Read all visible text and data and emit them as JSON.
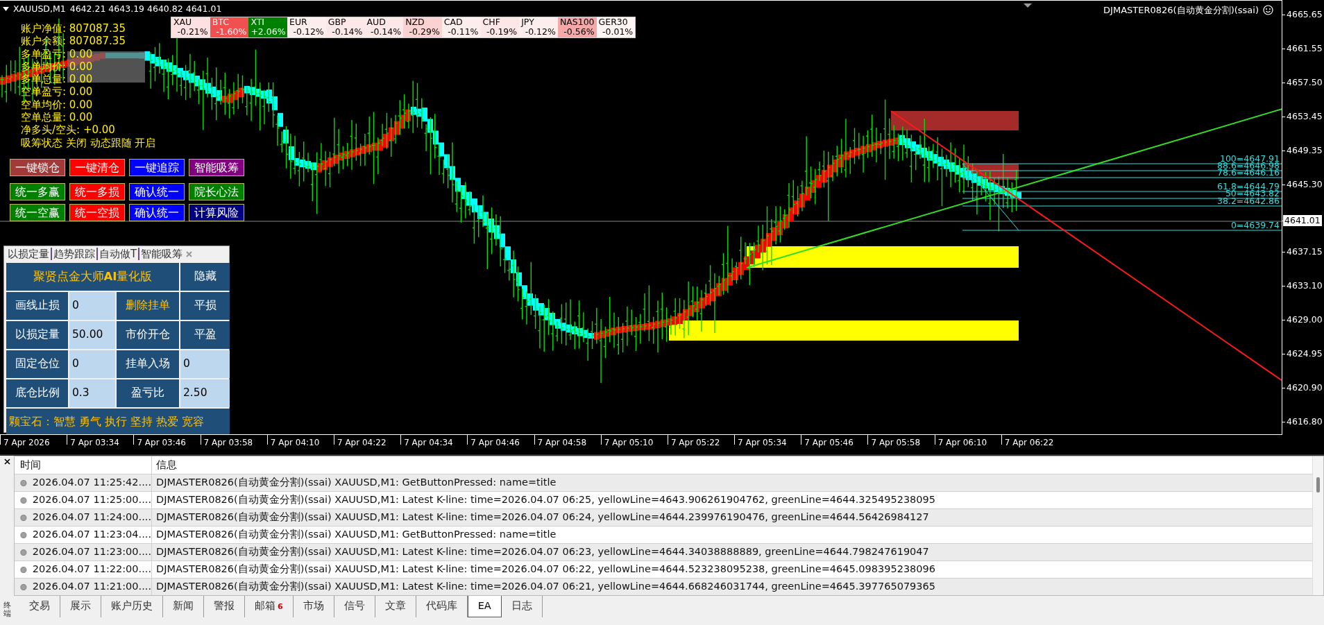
{
  "chart": {
    "symbol": "XAUUSD,M1",
    "quotes": "4642.21 4643.19 4640.82 4641.01",
    "expert": "DJMASTER0826(自动黄金分割)(ssai)"
  },
  "currency_strip": [
    {
      "symbol": "XAU",
      "change": "-0.21%",
      "color": "#fde0e0"
    },
    {
      "symbol": "BTC",
      "change": "-1.60%",
      "color": "#f05050"
    },
    {
      "symbol": "XTI",
      "change": "+2.06%",
      "color": "#008000"
    },
    {
      "symbol": "EUR",
      "change": "-0.12%",
      "color": "#fdeeee"
    },
    {
      "symbol": "GBP",
      "change": "-0.14%",
      "color": "#fde8e8"
    },
    {
      "symbol": "AUD",
      "change": "-0.14%",
      "color": "#fde8e8"
    },
    {
      "symbol": "NZD",
      "change": "-0.29%",
      "color": "#fbd2d2"
    },
    {
      "symbol": "CAD",
      "change": "-0.11%",
      "color": "#fdeeee"
    },
    {
      "symbol": "CHF",
      "change": "-0.19%",
      "color": "#fde6e6"
    },
    {
      "symbol": "JPY",
      "change": "-0.12%",
      "color": "#fdeeee"
    },
    {
      "symbol": "NAS100",
      "change": "-0.56%",
      "color": "#f5a8a8"
    },
    {
      "symbol": "GER30",
      "change": "-0.01%",
      "color": "#fff4f4"
    }
  ],
  "account_lines": [
    "账户净值: 807087.35",
    "账户余额: 807087.35",
    "多单盈亏: 0.00",
    "多单均价: 0.00",
    "多单总量: 0.00",
    "空单盈亏: 0.00",
    "空单均价: 0.00",
    "空单总量: 0.00",
    "净多头/空头: +0.00",
    "吸筹状态 关闭 动态跟随 开启"
  ],
  "action_buttons": [
    [
      {
        "label": "一键锁仓",
        "color": "#a33a3a"
      },
      {
        "label": "一键清仓",
        "color": "#ff0000"
      },
      {
        "label": "一键追踪",
        "color": "#0000ff"
      },
      {
        "label": "智能吸筹",
        "color": "#800080"
      }
    ],
    [
      {
        "label": "统一多赢",
        "color": "#008000"
      },
      {
        "label": "统一多损",
        "color": "#ff0000"
      },
      {
        "label": "确认统一",
        "color": "#0000ff"
      },
      {
        "label": "院长心法",
        "color": "#008000"
      }
    ],
    [
      {
        "label": "统一空赢",
        "color": "#008000"
      },
      {
        "label": "统一空损",
        "color": "#ff0000"
      },
      {
        "label": "确认统一",
        "color": "#0000ff"
      },
      {
        "label": "计算风险",
        "color": "#000080"
      }
    ]
  ],
  "fibonacci_levels": [
    "100=4647.91",
    "88.6=4646.98",
    "78.6=4646.16",
    "61.8=4644.79",
    "50=4643.82",
    "38.2=4642.86",
    "0=4639.74"
  ],
  "price_axis": [
    {
      "label": "4665.65",
      "kind": "tick"
    },
    {
      "label": "4661.55",
      "kind": "tick"
    },
    {
      "label": "4657.50",
      "kind": "tick"
    },
    {
      "label": "4653.45",
      "kind": "tick"
    },
    {
      "label": "4649.35",
      "kind": "tick"
    },
    {
      "label": "4645.30",
      "kind": "tick"
    },
    {
      "label": "4641.01",
      "kind": "current"
    },
    {
      "label": "4637.15",
      "kind": "tick"
    },
    {
      "label": "4633.10",
      "kind": "tick"
    },
    {
      "label": "4629.00",
      "kind": "tick"
    },
    {
      "label": "4624.95",
      "kind": "tick"
    },
    {
      "label": "4620.90",
      "kind": "tick"
    },
    {
      "label": "4616.80",
      "kind": "tick"
    }
  ],
  "time_axis": [
    "7 Apr 2026",
    "7 Apr 03:34",
    "7 Apr 03:46",
    "7 Apr 03:58",
    "7 Apr 04:10",
    "7 Apr 04:22",
    "7 Apr 04:34",
    "7 Apr 04:46",
    "7 Apr 04:58",
    "7 Apr 05:10",
    "7 Apr 05:22",
    "7 Apr 05:34",
    "7 Apr 05:46",
    "7 Apr 05:58",
    "7 Apr 06:10",
    "7 Apr 06:22"
  ],
  "panel": {
    "tabs": [
      "以损定量",
      "趋势跟踪",
      "自动做T",
      "智能吸筹"
    ],
    "title": "聚贤点金大师**AI**量化版",
    "hide_button": "隐藏",
    "rows": [
      [
        {
          "kind": "label",
          "text": "画线止损"
        },
        {
          "kind": "value",
          "text": "0"
        },
        {
          "kind": "accent",
          "text": "删除挂单"
        },
        {
          "kind": "label",
          "text": "平损"
        }
      ],
      [
        {
          "kind": "label",
          "text": "以损定量"
        },
        {
          "kind": "value",
          "text": "50.00"
        },
        {
          "kind": "label",
          "text": "市价开仓"
        },
        {
          "kind": "label",
          "text": "平盈"
        }
      ],
      [
        {
          "kind": "label",
          "text": "固定仓位"
        },
        {
          "kind": "value",
          "text": "0"
        },
        {
          "kind": "label",
          "text": "挂单入场"
        },
        {
          "kind": "value",
          "text": "0"
        }
      ],
      [
        {
          "kind": "label",
          "text": "底仓比例"
        },
        {
          "kind": "value",
          "text": "0.3"
        },
        {
          "kind": "label",
          "text": "盈亏比"
        },
        {
          "kind": "value",
          "text": "2.50"
        }
      ]
    ],
    "marquee": "颗宝石：智慧 勇气 执行 坚持 热爱 宽容"
  },
  "terminal": {
    "side_label": "终端",
    "columns": [
      "时间",
      "信息"
    ],
    "rows": [
      {
        "time": "2026.04.07 11:25:42....",
        "message": "DJMASTER0826(自动黄金分割)(ssai) XAUUSD,M1: GetButtonPressed: name=title"
      },
      {
        "time": "2026.04.07 11:25:00....",
        "message": "DJMASTER0826(自动黄金分割)(ssai) XAUUSD,M1: Latest K-line: time=2026.04.07 06:25, yellowLine=4643.906261904762, greenLine=4644.325495238095"
      },
      {
        "time": "2026.04.07 11:24:00....",
        "message": "DJMASTER0826(自动黄金分割)(ssai) XAUUSD,M1: Latest K-line: time=2026.04.07 06:24, yellowLine=4644.239976190476, greenLine=4644.56426984127"
      },
      {
        "time": "2026.04.07 11:23:04....",
        "message": "DJMASTER0826(自动黄金分割)(ssai) XAUUSD,M1: GetButtonPressed: name=title"
      },
      {
        "time": "2026.04.07 11:23:00....",
        "message": "DJMASTER0826(自动黄金分割)(ssai) XAUUSD,M1: Latest K-line: time=2026.04.07 06:23, yellowLine=4644.34038888889, greenLine=4644.798247619047"
      },
      {
        "time": "2026.04.07 11:22:00....",
        "message": "DJMASTER0826(自动黄金分割)(ssai) XAUUSD,M1: Latest K-line: time=2026.04.07 06:22, yellowLine=4644.523238095238, greenLine=4645.098395238096"
      },
      {
        "time": "2026.04.07 11:21:00....",
        "message": "DJMASTER0826(自动黄金分割)(ssai) XAUUSD,M1: Latest K-line: time=2026.04.07 06:21, yellowLine=4644.668246031744, greenLine=4645.397765079365"
      }
    ],
    "tabs": [
      {
        "label": "交易",
        "selected": false
      },
      {
        "label": "展示",
        "selected": false
      },
      {
        "label": "账户历史",
        "selected": false
      },
      {
        "label": "新闻",
        "selected": false
      },
      {
        "label": "警报",
        "selected": false
      },
      {
        "label": "邮箱",
        "selected": false,
        "badge": "6"
      },
      {
        "label": "市场",
        "selected": false
      },
      {
        "label": "信号",
        "selected": false
      },
      {
        "label": "文章",
        "selected": false
      },
      {
        "label": "代码库",
        "selected": false
      },
      {
        "label": "EA",
        "selected": true
      },
      {
        "label": "日志",
        "selected": false
      }
    ]
  }
}
